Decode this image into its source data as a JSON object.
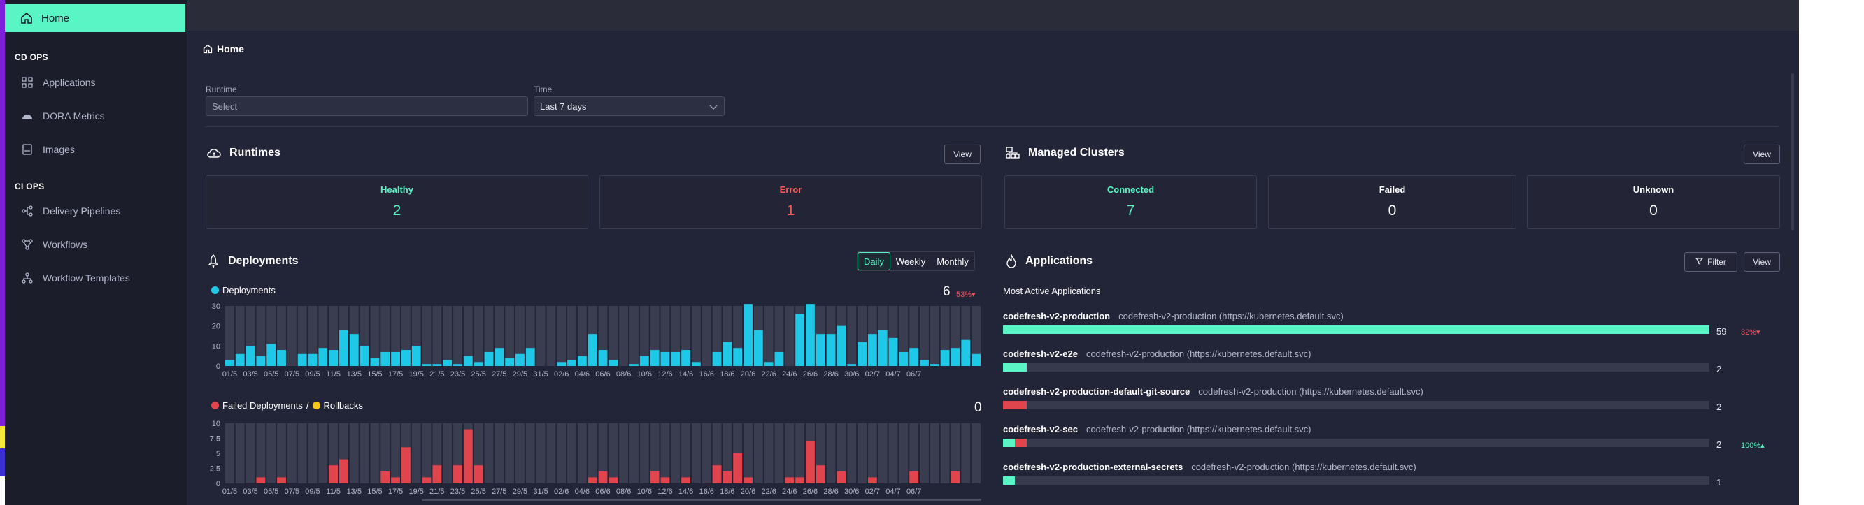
{
  "sidebar": {
    "home": "Home",
    "cd_section": "CD OPS",
    "cd_items": [
      "Applications",
      "DORA Metrics",
      "Images"
    ],
    "ci_section": "CI OPS",
    "ci_items": [
      "Delivery Pipelines",
      "Workflows",
      "Workflow Templates"
    ]
  },
  "breadcrumb": "Home",
  "filters": {
    "runtime_label": "Runtime",
    "runtime_placeholder": "Select",
    "time_label": "Time",
    "time_value": "Last 7 days"
  },
  "runtimes": {
    "title": "Runtimes",
    "view_label": "View",
    "stats": [
      {
        "label": "Healthy",
        "value": "2",
        "color": "#5af5c4"
      },
      {
        "label": "Error",
        "value": "1",
        "color": "#f25a5a"
      }
    ]
  },
  "clusters": {
    "title": "Managed Clusters",
    "view_label": "View",
    "stats": [
      {
        "label": "Connected",
        "value": "7",
        "color": "#5af5c4"
      },
      {
        "label": "Failed",
        "value": "0",
        "color": "#ffffff"
      },
      {
        "label": "Unknown",
        "value": "0",
        "color": "#ffffff"
      }
    ]
  },
  "deployments": {
    "title": "Deployments",
    "tabs": [
      "Daily",
      "Weekly",
      "Monthly"
    ],
    "active_tab": "Daily",
    "series_label": "Deployments",
    "total": "6",
    "trend": "53%",
    "failed_label": "Failed Deployments",
    "separator": "/",
    "rollbacks_label": "Rollbacks",
    "failed_total": "0"
  },
  "applications": {
    "title": "Applications",
    "filter_label": "Filter",
    "view_label": "View",
    "subtitle": "Most Active Applications",
    "max": 59,
    "items": [
      {
        "name": "codefresh-v2-production",
        "dest": "codefresh-v2-production (https://kubernetes.default.svc)",
        "count": "59",
        "healthy": 59,
        "failed": 0,
        "trend": "32%",
        "trend_dir": "down"
      },
      {
        "name": "codefresh-v2-e2e",
        "dest": "codefresh-v2-production (https://kubernetes.default.svc)",
        "count": "2",
        "healthy": 2,
        "failed": 0,
        "trend": "",
        "trend_dir": ""
      },
      {
        "name": "codefresh-v2-production-default-git-source",
        "dest": "codefresh-v2-production (https://kubernetes.default.svc)",
        "count": "2",
        "healthy": 0,
        "failed": 2,
        "trend": "",
        "trend_dir": ""
      },
      {
        "name": "codefresh-v2-sec",
        "dest": "codefresh-v2-production (https://kubernetes.default.svc)",
        "count": "2",
        "healthy": 1,
        "failed": 1,
        "trend": "100%",
        "trend_dir": "up"
      },
      {
        "name": "codefresh-v2-production-external-secrets",
        "dest": "codefresh-v2-production (https://kubernetes.default.svc)",
        "count": "1",
        "healthy": 1,
        "failed": 0,
        "trend": "",
        "trend_dir": ""
      }
    ]
  },
  "colors": {
    "accent": "#5af5c4",
    "deploy_bar": "#1ec8e6",
    "failed_bar": "#e0454d",
    "rollback": "#f5c518",
    "bar_bg": "#3a3d4f"
  },
  "chart_data": [
    {
      "type": "bar",
      "title": "Deployments",
      "ylim": [
        0,
        30
      ],
      "yticks": [
        0,
        10,
        20,
        30
      ],
      "xtick_labels": [
        "01/5",
        "03/5",
        "05/5",
        "07/5",
        "09/5",
        "11/5",
        "13/5",
        "15/5",
        "17/5",
        "19/5",
        "21/5",
        "23/5",
        "25/5",
        "27/5",
        "29/5",
        "31/5",
        "02/6",
        "04/6",
        "06/6",
        "08/6",
        "10/6",
        "12/6",
        "14/6",
        "16/6",
        "18/6",
        "20/6",
        "22/6",
        "24/6",
        "26/6",
        "28/6",
        "30/6",
        "02/7",
        "04/7",
        "06/7"
      ],
      "values": [
        3,
        6,
        10,
        5,
        11,
        8,
        0,
        6,
        6,
        9,
        8,
        18,
        16,
        10,
        4,
        7,
        7,
        8,
        10,
        1,
        1,
        3,
        1,
        5,
        2,
        7,
        9,
        4,
        6,
        9,
        0,
        0,
        2,
        3,
        5,
        16,
        8,
        3,
        0,
        1,
        5,
        8,
        7,
        7,
        8,
        2,
        0,
        7,
        12,
        9,
        31,
        18,
        2,
        7,
        0,
        26,
        31,
        16,
        16,
        20,
        1,
        12,
        16,
        18,
        14,
        7,
        9,
        3,
        1,
        8,
        9,
        13,
        6
      ]
    },
    {
      "type": "bar",
      "title": "Failed Deployments / Rollbacks",
      "ylim": [
        0,
        10
      ],
      "yticks": [
        "0",
        "2.5",
        "5",
        "7.5",
        "10"
      ],
      "xtick_labels": [
        "01/5",
        "03/5",
        "05/5",
        "07/5",
        "09/5",
        "11/5",
        "13/5",
        "15/5",
        "17/5",
        "19/5",
        "21/5",
        "23/5",
        "25/5",
        "27/5",
        "29/5",
        "31/5",
        "02/6",
        "04/6",
        "06/6",
        "08/6",
        "10/6",
        "12/6",
        "14/6",
        "16/6",
        "18/6",
        "20/6",
        "22/6",
        "24/6",
        "26/6",
        "28/6",
        "30/6",
        "02/7",
        "04/7",
        "06/7"
      ],
      "series": [
        {
          "name": "Failed Deployments",
          "values": [
            0,
            0,
            0,
            1,
            0,
            1,
            0,
            0,
            0,
            0,
            3,
            4,
            0,
            0,
            0,
            2,
            1,
            6,
            0,
            1,
            3,
            0,
            3,
            9,
            3,
            0,
            0,
            0,
            0,
            0,
            0,
            0,
            0,
            0,
            0,
            1,
            2,
            1,
            0,
            0,
            0,
            2,
            1,
            0,
            1,
            0,
            0,
            3,
            2,
            5,
            1,
            0,
            0,
            0,
            1,
            1,
            7,
            3,
            0,
            2,
            0,
            0,
            1,
            0,
            0,
            0,
            2,
            0,
            0,
            0,
            2,
            0,
            0
          ]
        },
        {
          "name": "Rollbacks",
          "values": [
            0,
            0,
            0,
            0,
            0,
            0,
            0,
            0,
            0,
            0,
            0,
            0,
            0,
            0,
            0,
            0,
            0,
            0,
            0,
            0,
            0,
            0,
            0,
            0,
            0,
            0,
            0,
            0,
            0,
            0,
            0,
            0,
            0,
            0,
            0,
            0,
            0,
            0,
            0,
            0,
            0,
            0,
            0,
            0,
            0,
            0,
            0,
            0,
            0,
            0,
            0,
            0,
            0,
            0,
            0,
            0,
            0,
            0,
            0,
            0,
            0,
            0,
            0,
            0,
            0,
            0,
            0,
            0,
            0,
            0,
            0,
            0,
            0
          ]
        }
      ]
    }
  ]
}
